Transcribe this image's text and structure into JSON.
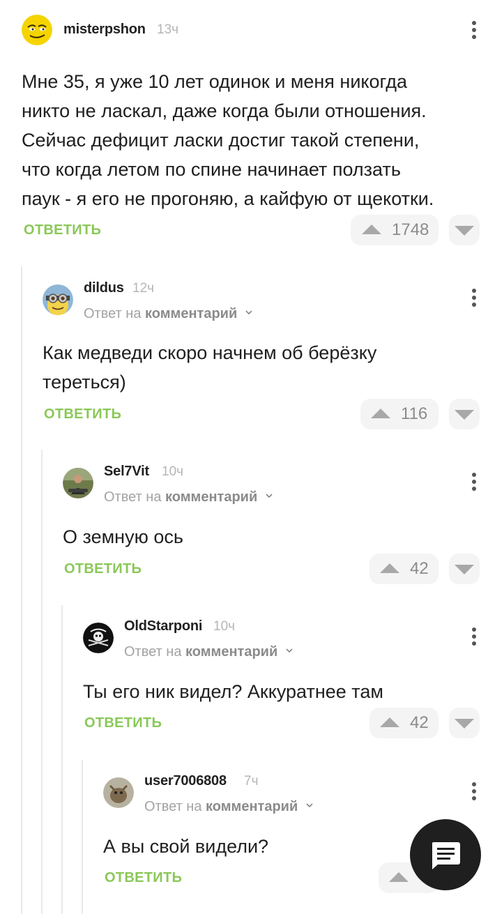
{
  "comments": [
    {
      "username": "misterpshon",
      "time": "13ч",
      "lines": [
        "Мне 35, я уже 10 лет одинок и меня никогда",
        "никто не ласкал, даже когда были отношения.",
        "Сейчас дефицит ласки достиг такой степени,",
        "что когда летом по спине начинает ползать",
        "паук - я его не прогоняю, а кайфую от щекотки."
      ],
      "reply_label": "ОТВЕТИТЬ",
      "votes": "1748"
    },
    {
      "username": "dildus",
      "time": "12ч",
      "reply_to_prefix": "Ответ на",
      "reply_to_link": "комментарий",
      "lines": [
        "Как медведи скоро начнем об берёзку",
        "тереться)"
      ],
      "reply_label": "ОТВЕТИТЬ",
      "votes": "116"
    },
    {
      "username": "Sel7Vit",
      "time": "10ч",
      "reply_to_prefix": "Ответ на",
      "reply_to_link": "комментарий",
      "lines": [
        "О земную ось"
      ],
      "reply_label": "ОТВЕТИТЬ",
      "votes": "42"
    },
    {
      "username": "OldStarponi",
      "time": "10ч",
      "reply_to_prefix": "Ответ на",
      "reply_to_link": "комментарий",
      "lines": [
        "Ты его ник видел? Аккуратнее там"
      ],
      "reply_label": "ОТВЕТИТЬ",
      "votes": "42"
    },
    {
      "username": "user7006808",
      "time": "7ч",
      "reply_to_prefix": "Ответ на",
      "reply_to_link": "комментарий",
      "lines": [
        "А вы свой видели?"
      ],
      "reply_label": "ОТВЕТИТЬ",
      "votes": ""
    }
  ],
  "colors": {
    "accent_green": "#8ac858",
    "text": "#1f1f1f",
    "muted": "#a3a3a3",
    "fab_bg": "#1f1f1f"
  },
  "icons": {
    "upvote": "triangle-up-icon",
    "downvote": "triangle-down-icon",
    "more": "kebab-icon",
    "chat": "chat-bubble-icon"
  }
}
